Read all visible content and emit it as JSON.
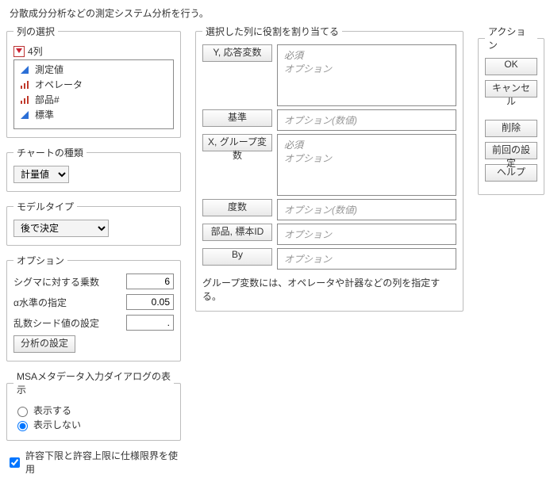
{
  "description": "分散成分分析などの測定システム分析を行う。",
  "column_select": {
    "legend": "列の選択",
    "count_label": "4列",
    "items": [
      {
        "label": "測定値",
        "icon": "cont-blue"
      },
      {
        "label": "オペレータ",
        "icon": "nom-red"
      },
      {
        "label": "部品#",
        "icon": "nom-red"
      },
      {
        "label": "標準",
        "icon": "cont-blue"
      }
    ]
  },
  "chart_type": {
    "legend": "チャートの種類",
    "value": "計量値"
  },
  "model_type": {
    "legend": "モデルタイプ",
    "value": "後で決定"
  },
  "options": {
    "legend": "オプション",
    "sigma_label": "シグマに対する乗数",
    "sigma_value": "6",
    "alpha_label": "α水準の指定",
    "alpha_value": "0.05",
    "seed_label": "乱数シード値の設定",
    "seed_value": ".",
    "analysis_settings_btn": "分析の設定"
  },
  "msa_meta": {
    "legend": "MSAメタデータ入力ダイアログの表示",
    "show": "表示する",
    "hide": "表示しない"
  },
  "spec_limits_checkbox": "許容下限と許容上限に仕様限界を使用",
  "roles": {
    "legend": "選択した列に役割を割り当てる",
    "y_label": "Y, 応答変数",
    "y_ph1": "必須",
    "y_ph2": "オプション",
    "std_label": "基準",
    "std_ph": "オプション(数値)",
    "x_label": "X, グループ変数",
    "x_ph1": "必須",
    "x_ph2": "オプション",
    "freq_label": "度数",
    "freq_ph": "オプション(数値)",
    "partid_label": "部品, 標本ID",
    "partid_ph": "オプション",
    "by_label": "By",
    "by_ph": "オプション",
    "hint": "グループ変数には、オペレータや計器などの列を指定する。"
  },
  "actions": {
    "legend": "アクション",
    "ok": "OK",
    "cancel": "キャンセル",
    "remove": "削除",
    "recall": "前回の設定",
    "help": "ヘルプ"
  }
}
